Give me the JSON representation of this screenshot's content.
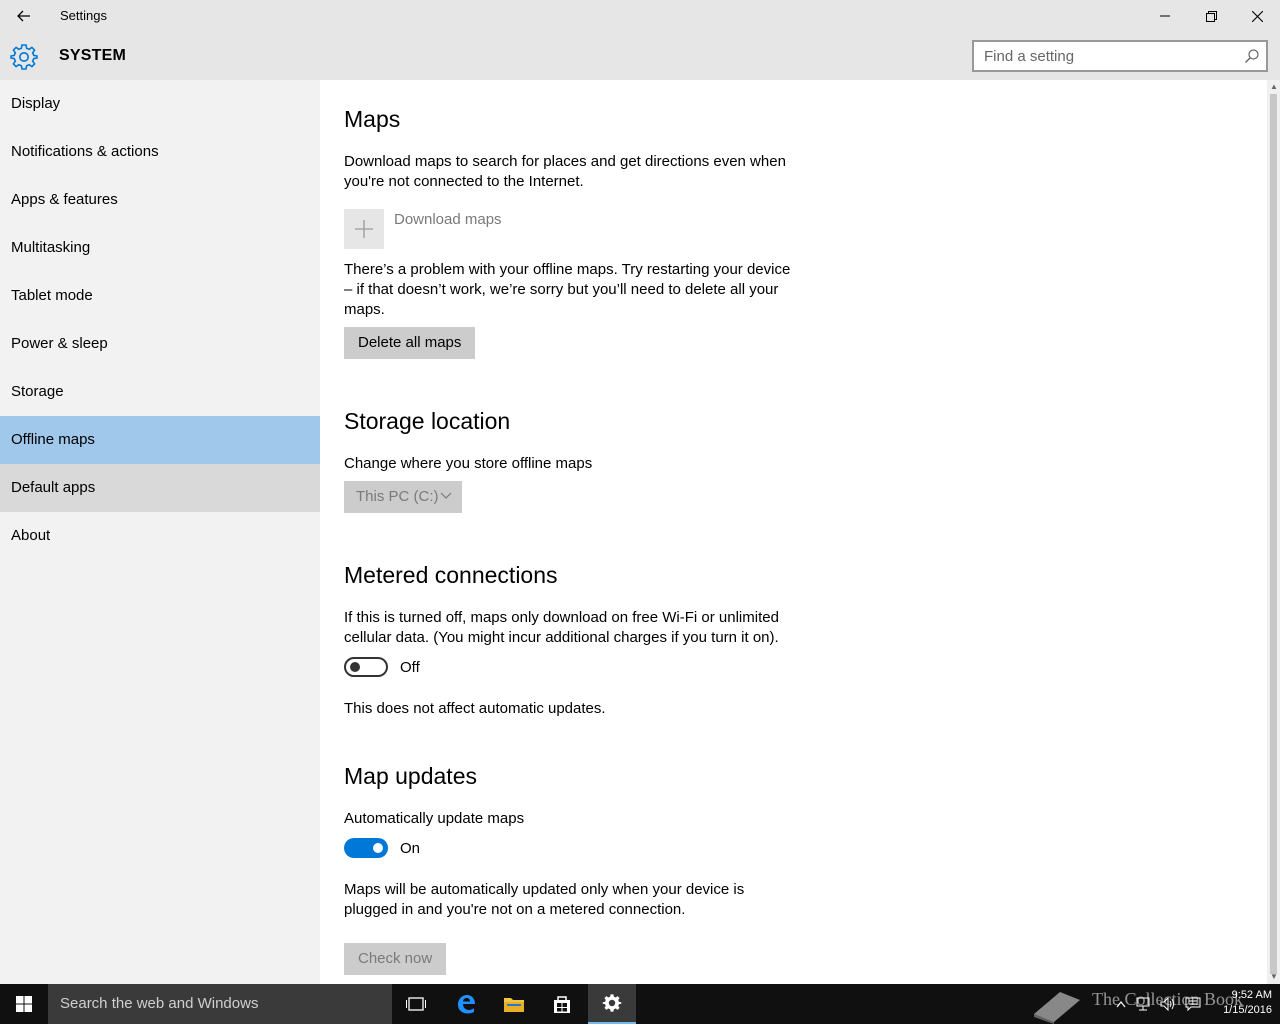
{
  "window": {
    "title": "Settings",
    "back_icon": "arrow-left",
    "minimize_icon": "minimize",
    "maximize_icon": "restore",
    "close_icon": "close"
  },
  "header": {
    "section_title": "SYSTEM",
    "search_placeholder": "Find a setting",
    "accent_color": "#0078d7"
  },
  "sidebar": {
    "items": [
      {
        "label": "Display"
      },
      {
        "label": "Notifications & actions"
      },
      {
        "label": "Apps & features"
      },
      {
        "label": "Multitasking"
      },
      {
        "label": "Tablet mode"
      },
      {
        "label": "Power & sleep"
      },
      {
        "label": "Storage"
      },
      {
        "label": "Offline maps",
        "selected": true
      },
      {
        "label": "Default apps",
        "hover": true
      },
      {
        "label": "About"
      }
    ],
    "selected_color": "#9fc8ea"
  },
  "maps": {
    "heading": "Maps",
    "description": "Download maps to search for places and get directions even when you're not connected to the Internet.",
    "download_label": "Download maps",
    "problem_text": "There’s a problem with your offline maps. Try restarting your device – if that doesn’t work, we’re sorry but you’ll need to delete all your maps.",
    "delete_button": "Delete all maps"
  },
  "storage": {
    "heading": "Storage location",
    "description": "Change where you store offline maps",
    "selected_value": "This PC (C:)"
  },
  "metered": {
    "heading": "Metered connections",
    "description": "If this is turned off, maps only download on free Wi-Fi or unlimited cellular data. (You might incur additional charges if you turn it on).",
    "toggle_state": "Off",
    "note": "This does not affect automatic updates."
  },
  "updates": {
    "heading": "Map updates",
    "description": "Automatically update maps",
    "toggle_state": "On",
    "note": "Maps will be automatically updated only when your device is plugged in and you're not on a metered connection.",
    "check_button": "Check now"
  },
  "taskbar": {
    "search_text": "Search the web and Windows",
    "time": "9:52 AM",
    "date": "1/15/2016",
    "watermark": "The Collection Book"
  }
}
